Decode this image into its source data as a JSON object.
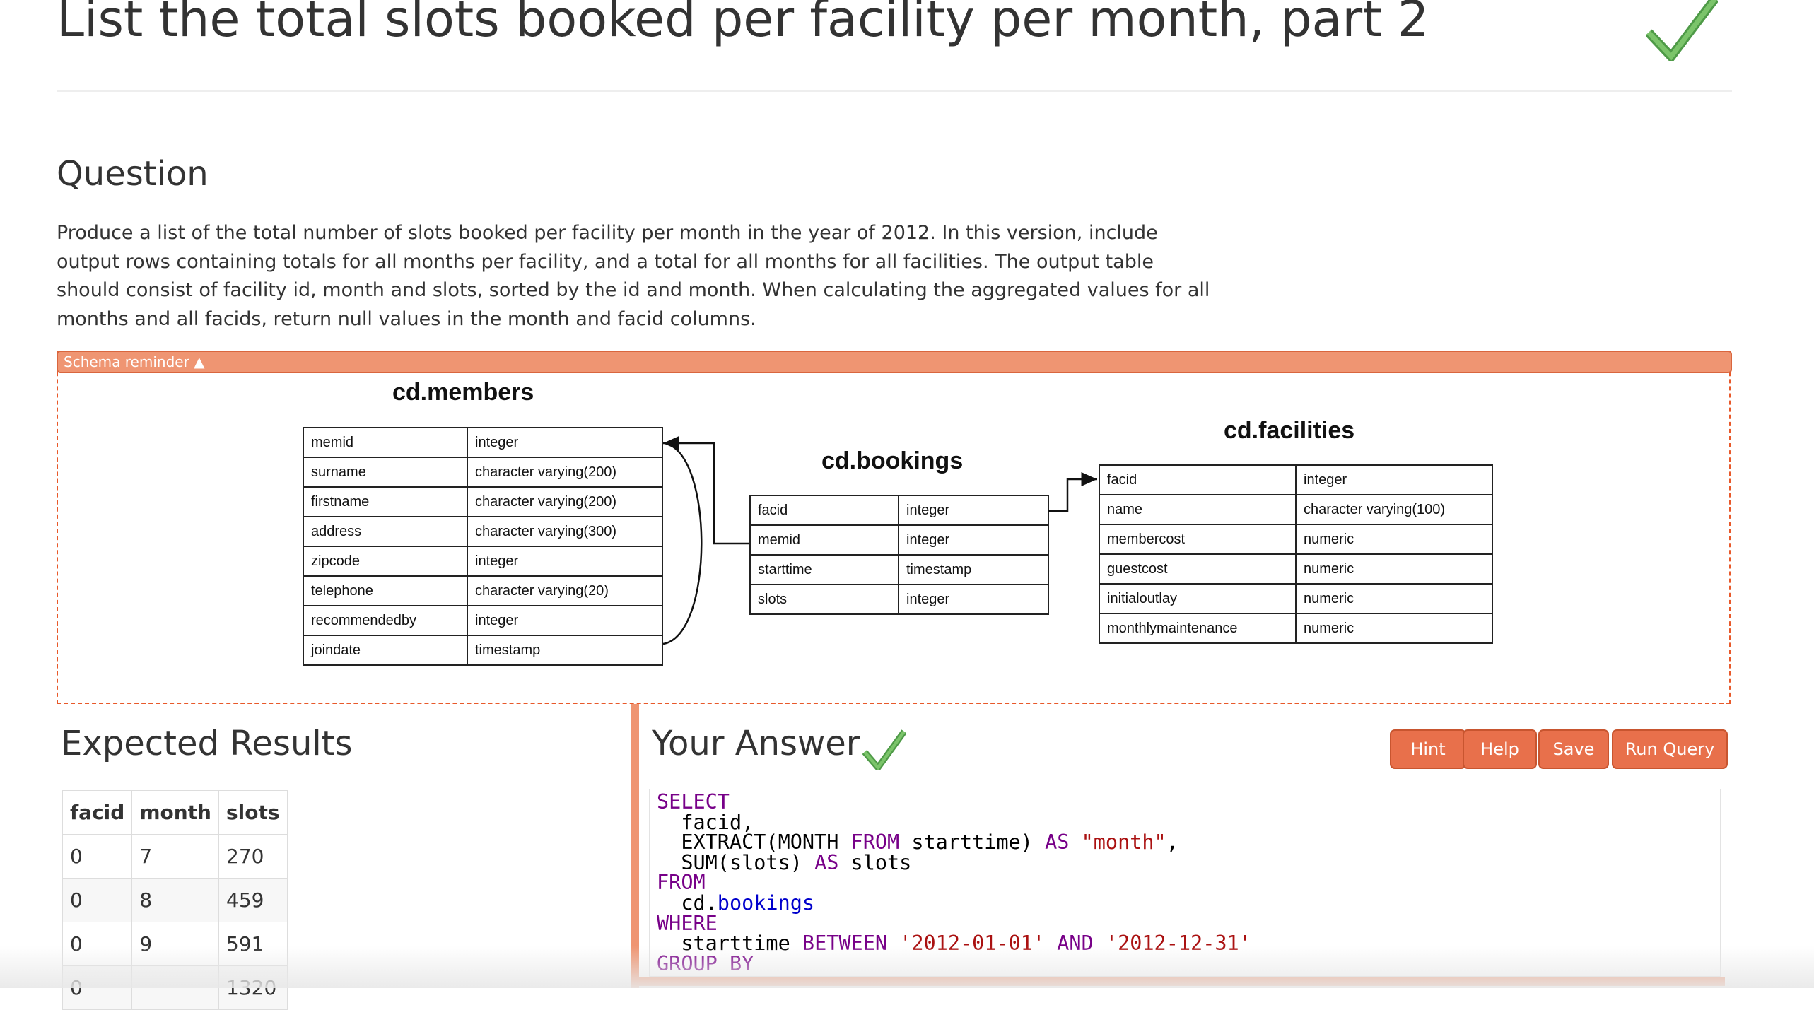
{
  "page": {
    "title": "List the total slots booked per facility per month, part 2"
  },
  "question": {
    "heading": "Question",
    "text": "Produce a list of the total number of slots booked per facility per month in the year of 2012. In this version, include output rows containing totals for all months per facility, and a total for all months for all facilities. The output table should consist of facility id, month and slots, sorted by the id and month. When calculating the aggregated values for all months and all facids, return null values in the month and facid columns."
  },
  "schema": {
    "toggle_label": "Schema reminder ▲",
    "members": {
      "title": "cd.members",
      "rows": [
        [
          "memid",
          "integer"
        ],
        [
          "surname",
          "character varying(200)"
        ],
        [
          "firstname",
          "character varying(200)"
        ],
        [
          "address",
          "character varying(300)"
        ],
        [
          "zipcode",
          "integer"
        ],
        [
          "telephone",
          "character varying(20)"
        ],
        [
          "recommendedby",
          "integer"
        ],
        [
          "joindate",
          "timestamp"
        ]
      ]
    },
    "bookings": {
      "title": "cd.bookings",
      "rows": [
        [
          "facid",
          "integer"
        ],
        [
          "memid",
          "integer"
        ],
        [
          "starttime",
          "timestamp"
        ],
        [
          "slots",
          "integer"
        ]
      ]
    },
    "facilities": {
      "title": "cd.facilities",
      "rows": [
        [
          "facid",
          "integer"
        ],
        [
          "name",
          "character varying(100)"
        ],
        [
          "membercost",
          "numeric"
        ],
        [
          "guestcost",
          "numeric"
        ],
        [
          "initialoutlay",
          "numeric"
        ],
        [
          "monthlymaintenance",
          "numeric"
        ]
      ]
    }
  },
  "expected": {
    "heading": "Expected Results",
    "columns": [
      "facid",
      "month",
      "slots"
    ],
    "rows": [
      [
        "0",
        "7",
        "270"
      ],
      [
        "0",
        "8",
        "459"
      ],
      [
        "0",
        "9",
        "591"
      ],
      [
        "0",
        "",
        "1320"
      ]
    ]
  },
  "answer": {
    "heading": "Your Answer",
    "buttons": {
      "hint": "Hint",
      "help": "Help",
      "save": "Save",
      "run": "Run Query"
    },
    "code_lines": [
      [
        [
          "kw",
          "SELECT"
        ]
      ],
      [
        [
          "",
          "  facid,"
        ]
      ],
      [
        [
          "",
          "  EXTRACT(MONTH "
        ],
        [
          "kw",
          "FROM"
        ],
        [
          "",
          " starttime) "
        ],
        [
          "kw",
          "AS"
        ],
        [
          "",
          " "
        ],
        [
          "str",
          "\"month\""
        ],
        [
          "",
          ","
        ]
      ],
      [
        [
          "",
          "  SUM(slots) "
        ],
        [
          "kw",
          "AS"
        ],
        [
          "",
          " slots"
        ]
      ],
      [
        [
          "kw",
          "FROM"
        ]
      ],
      [
        [
          "",
          "  cd."
        ],
        [
          "prop",
          "bookings"
        ]
      ],
      [
        [
          "kw",
          "WHERE"
        ]
      ],
      [
        [
          "",
          "  starttime "
        ],
        [
          "kw",
          "BETWEEN"
        ],
        [
          "",
          " "
        ],
        [
          "str",
          "'2012-01-01'"
        ],
        [
          "",
          " "
        ],
        [
          "kw",
          "AND"
        ],
        [
          "",
          " "
        ],
        [
          "str",
          "'2012-12-31'"
        ]
      ],
      [
        [
          "kw",
          "GROUP BY"
        ]
      ]
    ]
  },
  "colors": {
    "accent": "#e8704b",
    "accent_light": "#ef9572",
    "check": "#5cb85c",
    "sql_keyword": "#770088",
    "sql_string": "#aa1111",
    "sql_property": "#0000cc"
  }
}
